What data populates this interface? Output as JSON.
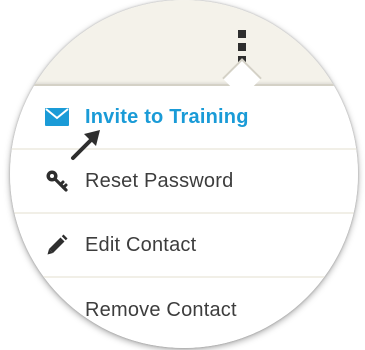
{
  "menu": {
    "items": [
      {
        "label": "Invite to Training",
        "icon": "envelope-icon",
        "active": true
      },
      {
        "label": "Reset Password",
        "icon": "key-icon",
        "active": false
      },
      {
        "label": "Edit Contact",
        "icon": "pencil-icon",
        "active": false
      },
      {
        "label": "Remove Contact",
        "icon": "trash-icon",
        "active": false
      }
    ]
  },
  "colors": {
    "accent": "#1a9bd7",
    "text": "#3d3d3d",
    "icon": "#2e2e2e",
    "header_bg": "#f4f2ea",
    "divider": "#f1efe7"
  }
}
